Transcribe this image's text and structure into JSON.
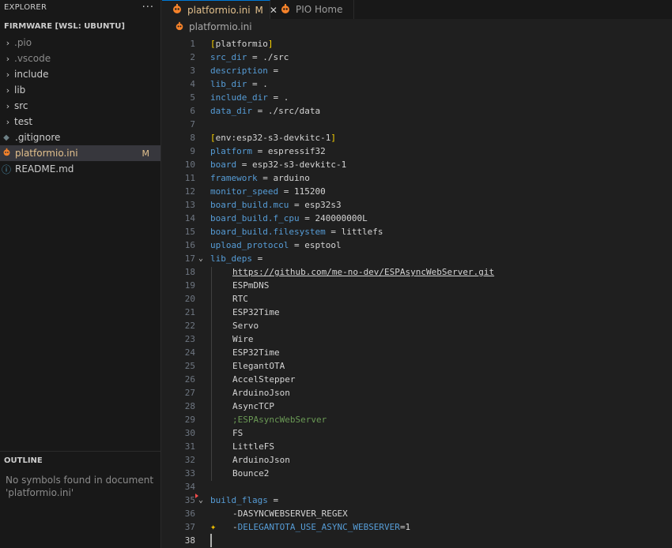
{
  "explorer": {
    "title": "EXPLORER",
    "more": "···",
    "folder": "FIRMWARE [WSL: UBUNTU]",
    "items": [
      {
        "label": ".pio",
        "type": "folder",
        "dim": true
      },
      {
        "label": ".vscode",
        "type": "folder",
        "dim": true
      },
      {
        "label": "include",
        "type": "folder"
      },
      {
        "label": "lib",
        "type": "folder"
      },
      {
        "label": "src",
        "type": "folder"
      },
      {
        "label": "test",
        "type": "folder"
      },
      {
        "label": ".gitignore",
        "type": "file",
        "icon": "gitignore-icon"
      },
      {
        "label": "platformio.ini",
        "type": "file",
        "icon": "platformio-icon",
        "selected": true,
        "badge": "M"
      },
      {
        "label": "README.md",
        "type": "file",
        "icon": "info-icon"
      }
    ]
  },
  "outline": {
    "title": "OUTLINE",
    "message": "No symbols found in document 'platformio.ini'"
  },
  "tabs": [
    {
      "label": "platformio.ini",
      "modified": "M",
      "close": "✕",
      "active": true
    },
    {
      "label": "PIO Home",
      "active": false
    }
  ],
  "breadcrumb": {
    "file": "platformio.ini"
  },
  "colors": {
    "accent": "#0078d4",
    "modified": "#e2c08d",
    "key": "#569cd6",
    "comment": "#6a9955",
    "bracket": "#ffd700"
  },
  "editor": {
    "lines": [
      {
        "n": "1",
        "tokens": [
          {
            "t": "[",
            "c": "br"
          },
          {
            "t": "platformio",
            "c": "sec"
          },
          {
            "t": "]",
            "c": "br"
          }
        ]
      },
      {
        "n": "2",
        "tokens": [
          {
            "t": "src_dir",
            "c": "k"
          },
          {
            "t": " = ./src",
            "c": "s"
          }
        ]
      },
      {
        "n": "3",
        "tokens": [
          {
            "t": "description",
            "c": "k"
          },
          {
            "t": " =",
            "c": "s"
          }
        ]
      },
      {
        "n": "4",
        "tokens": [
          {
            "t": "lib_dir",
            "c": "k"
          },
          {
            "t": " = .",
            "c": "s"
          }
        ]
      },
      {
        "n": "5",
        "tokens": [
          {
            "t": "include_dir",
            "c": "k"
          },
          {
            "t": " = .",
            "c": "s"
          }
        ]
      },
      {
        "n": "6",
        "tokens": [
          {
            "t": "data_dir",
            "c": "k"
          },
          {
            "t": " = ./src/data",
            "c": "s"
          }
        ]
      },
      {
        "n": "7",
        "tokens": []
      },
      {
        "n": "8",
        "tokens": [
          {
            "t": "[",
            "c": "br"
          },
          {
            "t": "env:esp32-s3-devkitc-1",
            "c": "sec"
          },
          {
            "t": "]",
            "c": "br"
          }
        ]
      },
      {
        "n": "9",
        "tokens": [
          {
            "t": "platform",
            "c": "k"
          },
          {
            "t": " = espressif32",
            "c": "s"
          }
        ]
      },
      {
        "n": "10",
        "tokens": [
          {
            "t": "board",
            "c": "k"
          },
          {
            "t": " = esp32-s3-devkitc-1",
            "c": "s"
          }
        ]
      },
      {
        "n": "11",
        "tokens": [
          {
            "t": "framework",
            "c": "k"
          },
          {
            "t": " = arduino",
            "c": "s"
          }
        ]
      },
      {
        "n": "12",
        "tokens": [
          {
            "t": "monitor_speed",
            "c": "k"
          },
          {
            "t": " = 115200",
            "c": "s"
          }
        ]
      },
      {
        "n": "13",
        "tokens": [
          {
            "t": "board_build.mcu",
            "c": "k"
          },
          {
            "t": " = esp32s3",
            "c": "s"
          }
        ]
      },
      {
        "n": "14",
        "tokens": [
          {
            "t": "board_build.f_cpu",
            "c": "k"
          },
          {
            "t": " = 240000000L",
            "c": "s"
          }
        ]
      },
      {
        "n": "15",
        "tokens": [
          {
            "t": "board_build.filesystem",
            "c": "k"
          },
          {
            "t": " = littlefs",
            "c": "s"
          }
        ]
      },
      {
        "n": "16",
        "tokens": [
          {
            "t": "upload_protocol",
            "c": "k"
          },
          {
            "t": " = esptool",
            "c": "s"
          }
        ]
      },
      {
        "n": "17",
        "fold": "⌄",
        "tokens": [
          {
            "t": "lib_deps",
            "c": "k"
          },
          {
            "t": " =",
            "c": "s"
          }
        ]
      },
      {
        "n": "18",
        "indent": true,
        "tokens": [
          {
            "t": "https://github.com/me-no-dev/ESPAsyncWebServer.git",
            "c": "url"
          }
        ]
      },
      {
        "n": "19",
        "indent": true,
        "tokens": [
          {
            "t": "ESPmDNS",
            "c": "s"
          }
        ]
      },
      {
        "n": "20",
        "indent": true,
        "tokens": [
          {
            "t": "RTC",
            "c": "s"
          }
        ]
      },
      {
        "n": "21",
        "indent": true,
        "tokens": [
          {
            "t": "ESP32Time",
            "c": "s"
          }
        ]
      },
      {
        "n": "22",
        "indent": true,
        "tokens": [
          {
            "t": "Servo",
            "c": "s"
          }
        ]
      },
      {
        "n": "23",
        "indent": true,
        "tokens": [
          {
            "t": "Wire",
            "c": "s"
          }
        ]
      },
      {
        "n": "24",
        "indent": true,
        "tokens": [
          {
            "t": "ESP32Time",
            "c": "s"
          }
        ]
      },
      {
        "n": "25",
        "indent": true,
        "tokens": [
          {
            "t": "ElegantOTA",
            "c": "s"
          }
        ]
      },
      {
        "n": "26",
        "indent": true,
        "tokens": [
          {
            "t": "AccelStepper",
            "c": "s"
          }
        ]
      },
      {
        "n": "27",
        "indent": true,
        "tokens": [
          {
            "t": "ArduinoJson",
            "c": "s"
          }
        ]
      },
      {
        "n": "28",
        "indent": true,
        "tokens": [
          {
            "t": "AsyncTCP",
            "c": "s"
          }
        ]
      },
      {
        "n": "29",
        "indent": true,
        "tokens": [
          {
            "t": ";ESPAsyncWebServer",
            "c": "cm"
          }
        ]
      },
      {
        "n": "30",
        "indent": true,
        "tokens": [
          {
            "t": "FS",
            "c": "s"
          }
        ]
      },
      {
        "n": "31",
        "indent": true,
        "tokens": [
          {
            "t": "LittleFS",
            "c": "s"
          }
        ]
      },
      {
        "n": "32",
        "indent": true,
        "tokens": [
          {
            "t": "ArduinoJson",
            "c": "s"
          }
        ]
      },
      {
        "n": "33",
        "indent": true,
        "tokens": [
          {
            "t": "Bounce2",
            "c": "s"
          }
        ]
      },
      {
        "n": "34",
        "tokens": []
      },
      {
        "n": "35",
        "fold": "⌄",
        "tokens": [
          {
            "t": "build_flags",
            "c": "k"
          },
          {
            "t": " =",
            "c": "s"
          }
        ]
      },
      {
        "n": "36",
        "indent": true,
        "tokens": [
          {
            "t": "-DASYNCWEBSERVER_REGEX",
            "c": "s"
          }
        ]
      },
      {
        "n": "37",
        "indent": true,
        "spark": true,
        "tokens": [
          {
            "t": "-",
            "c": "s"
          },
          {
            "t": "DELEGANTOTA_USE_ASYNC_WEBSERVER",
            "c": "k"
          },
          {
            "t": "=1",
            "c": "s"
          }
        ]
      },
      {
        "n": "38",
        "current": true,
        "tokens": []
      }
    ]
  }
}
